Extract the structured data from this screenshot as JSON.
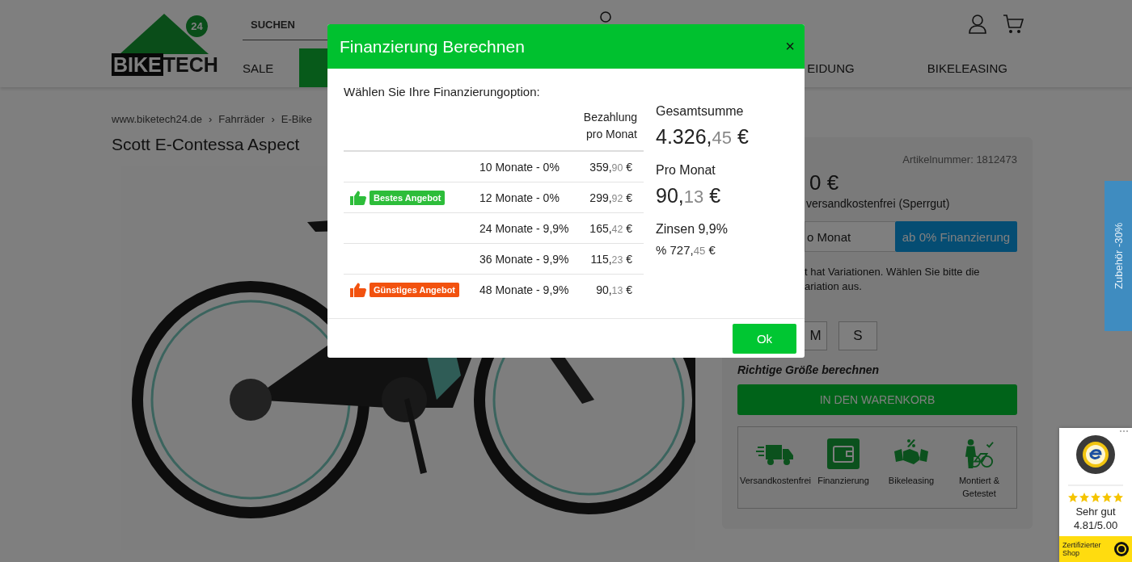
{
  "header": {
    "logo": {
      "part_1": "BIKE",
      "part_2": "TECH",
      "badge": "24"
    },
    "search": {
      "placeholder": "SUCHEN"
    },
    "nav": [
      {
        "label": "SALE",
        "selected": false
      },
      {
        "selected": true
      },
      {
        "label": "EIDUNG",
        "selected": false
      },
      {
        "label": "BIKELEASING",
        "selected": false
      }
    ]
  },
  "breadcrumb": {
    "separator": "›",
    "items": [
      "www.biketech24.de",
      "Fahrräder",
      "E-Bike"
    ]
  },
  "product_title": "Scott E-Contessa Aspect",
  "product_panel": {
    "article_number": "Artikelnummer: 1812473",
    "price": "0 €",
    "shipping": "versandkostenfrei (Sperrgut)",
    "monthly_field": {
      "value": "o Monat"
    },
    "financing_button": "ab 0% Finanzierung",
    "notice_lines": [
      "t hat Variationen. Wählen Sie bitte die",
      "ariation aus."
    ],
    "sizes": [
      {
        "label": "M"
      },
      {
        "label": "S"
      }
    ],
    "size_link": "Richtige Größe berechnen",
    "cart_button": "IN DEN WARENKORB",
    "features": [
      {
        "kind": "truck",
        "label": "Versandkostenfrei"
      },
      {
        "kind": "wallet",
        "label": "Finanzierung"
      },
      {
        "kind": "handshake",
        "label": "Bikeleasing"
      },
      {
        "kind": "mechanic",
        "label": "Montiert & Getestet"
      }
    ]
  },
  "side_tab": "Zubehör -30%",
  "trust_badge": {
    "stars": 5,
    "rating_label": "Sehr gut",
    "score": "4.81/5.00",
    "footer": "Zertifizierter Shop"
  },
  "modal": {
    "title": "Finanzierung Berechnen",
    "close": "×",
    "prompt": "Wählen Sie Ihre Finanzierungoption:",
    "amount_header": "Bezahlung pro Monat",
    "options": [
      {
        "term": "10 Monate - 0%",
        "amount": {
          "main": "359,",
          "cents": "90",
          "currency": "€"
        }
      },
      {
        "badge": {
          "label": "Bestes Angebot",
          "color": "#2dbd3a"
        },
        "term": "12 Monate - 0%",
        "amount": {
          "main": "299,",
          "cents": "92",
          "currency": "€"
        }
      },
      {
        "term": "24 Monate - 9,9%",
        "amount": {
          "main": "165,",
          "cents": "42",
          "currency": "€"
        }
      },
      {
        "term": "36 Monate - 9,9%",
        "amount": {
          "main": "115,",
          "cents": "23",
          "currency": "€"
        }
      },
      {
        "badge": {
          "label": "Günstiges Angebot",
          "color": "#f2520f"
        },
        "term": "48 Monate - 9,9%",
        "amount": {
          "main": "90,",
          "cents": "13",
          "currency": "€"
        }
      }
    ],
    "summary": {
      "total_label": "Gesamtsumme",
      "total": {
        "main": "4.326,",
        "cents": "45",
        "currency": "€"
      },
      "monthly_label": "Pro Monat",
      "monthly": {
        "main": "90,",
        "cents": "13",
        "currency": "€"
      },
      "interest_label": "Zinsen 9,9%",
      "interest": {
        "prefix": "%",
        "main": "727,",
        "cents": "45",
        "currency": "€"
      }
    },
    "ok_button": "Ok"
  }
}
